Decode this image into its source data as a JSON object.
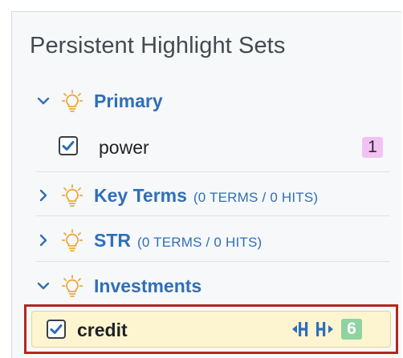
{
  "panel": {
    "title": "Persistent Highlight Sets"
  },
  "sets": [
    {
      "name": "Primary",
      "expanded": true,
      "meta": "",
      "terms": [
        {
          "label": "power",
          "checked": true,
          "count": "1",
          "badge_color": "#f3c2f5"
        }
      ]
    },
    {
      "name": "Key Terms",
      "expanded": false,
      "meta": "(0 TERMS / 0 HITS)",
      "terms": []
    },
    {
      "name": "STR",
      "expanded": false,
      "meta": "(0 TERMS / 0 HITS)",
      "terms": []
    },
    {
      "name": "Investments",
      "expanded": true,
      "meta": "",
      "terms": [
        {
          "label": "credit",
          "checked": true,
          "count": "6",
          "badge_color": "#8fd3a0",
          "selected": true,
          "nav_prev_icon": "jump-prev-icon",
          "nav_next_icon": "jump-next-icon"
        }
      ]
    }
  ],
  "colors": {
    "accent_blue": "#2f6fb7",
    "bulb_orange": "#f0a83a",
    "selection_outline": "#b3261e",
    "selected_bg": "#fdf4d0"
  }
}
